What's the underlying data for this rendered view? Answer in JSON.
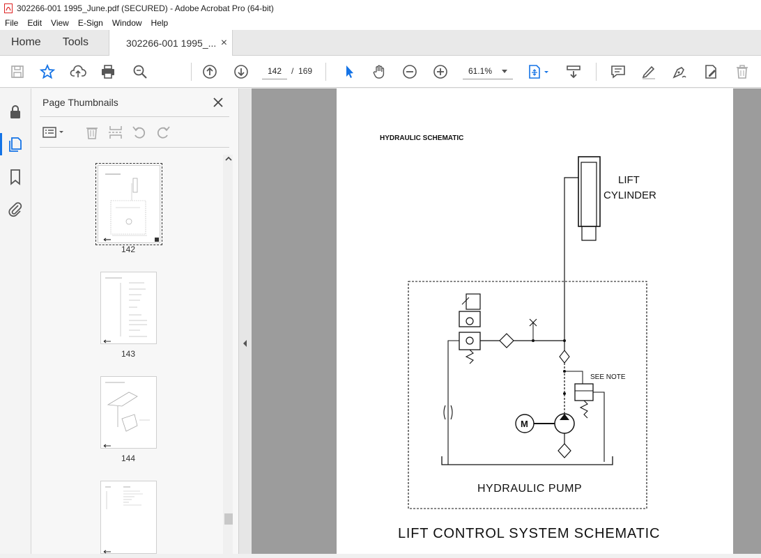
{
  "window": {
    "title": "302266-001 1995_June.pdf (SECURED) - Adobe Acrobat Pro (64-bit)"
  },
  "menu": {
    "items": [
      "File",
      "Edit",
      "View",
      "E-Sign",
      "Window",
      "Help"
    ]
  },
  "tabs": {
    "home": "Home",
    "tools": "Tools",
    "document": "302266-001 1995_...",
    "close": "×"
  },
  "toolbar": {
    "current_page": "142",
    "page_separator": "/",
    "total_pages": "169",
    "zoom": "61.1%"
  },
  "panel": {
    "title": "Page Thumbnails",
    "thumbnails": [
      {
        "label": "142",
        "selected": true
      },
      {
        "label": "143",
        "selected": false
      },
      {
        "label": "144",
        "selected": false
      }
    ]
  },
  "document": {
    "heading": "HYDRAULIC SCHEMATIC",
    "lift_cylinder_line1": "LIFT",
    "lift_cylinder_line2": "CYLINDER",
    "see_note": "SEE NOTE",
    "motor_label": "M",
    "pump_label": "HYDRAULIC PUMP",
    "caption": "LIFT CONTROL SYSTEM SCHEMATIC"
  },
  "colors": {
    "accent": "#1473e6",
    "icon": "#555555",
    "doc_background": "#9c9c9c"
  }
}
